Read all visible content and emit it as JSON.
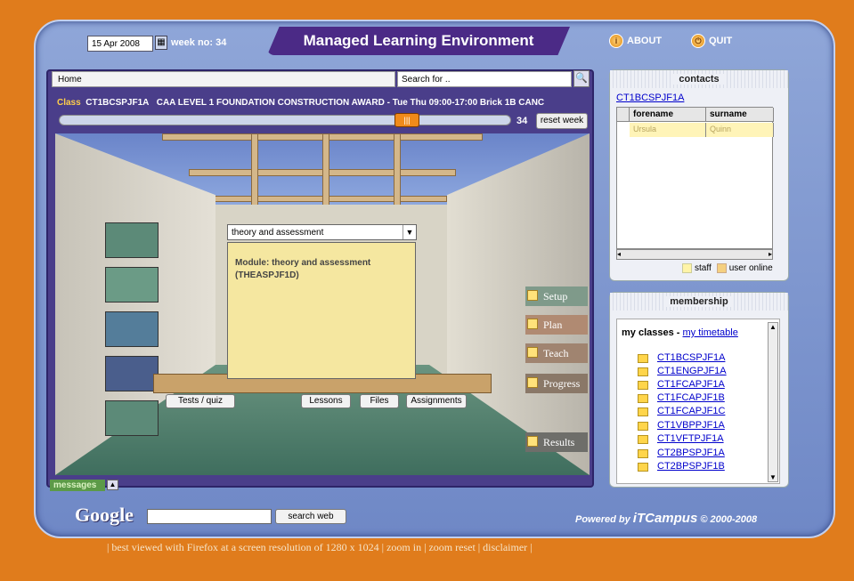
{
  "header": {
    "date": "15 Apr 2008",
    "week_label": "week no: 34",
    "app_title": "Managed Learning Environment",
    "about_label": "ABOUT",
    "quit_label": "QUIT"
  },
  "nav": {
    "home_label": "Home",
    "search_placeholder": "Search for .."
  },
  "class_info": {
    "label": "Class",
    "code": "CT1BCSPJF1A",
    "description": "CAA LEVEL 1 FOUNDATION CONSTRUCTION AWARD - Tue Thu 09:00-17:00 Brick 1B CANC",
    "week_value": "34",
    "reset_label": "reset week"
  },
  "module": {
    "selected": "theory and assessment",
    "text": "Module: theory and assessment (THEASPJF1D)"
  },
  "room_buttons": {
    "tests": "Tests / quiz",
    "lessons": "Lessons",
    "files": "Files",
    "assignments": "Assignments"
  },
  "side_menu": [
    "Setup",
    "Plan",
    "Teach",
    "Progress",
    "Results"
  ],
  "messages": {
    "label": "messages"
  },
  "google": {
    "logo": "Google",
    "search_label": "search web"
  },
  "powered": {
    "prefix": "Powered by ",
    "brand": "iTCampus",
    "suffix": " © 2000-2008"
  },
  "footer": "| best viewed with Firefox at a screen resolution of 1280 x 1024 | zoom in | zoom reset | disclaimer |",
  "contacts": {
    "title": "contacts",
    "class_link": "CT1BCSPJF1A",
    "col_forename": "forename",
    "col_surname": "surname",
    "row_forename": "Ursula",
    "row_surname": "Quinn",
    "legend_staff": "staff",
    "legend_online": "user online",
    "staff_color": "#fff4a8",
    "online_color": "#f5d080"
  },
  "membership": {
    "title": "membership",
    "my_classes": "my classes",
    "sep": " - ",
    "timetable_link": "my timetable",
    "classes": [
      "CT1BCSPJF1A",
      "CT1ENGPJF1A",
      "CT1FCAPJF1A",
      "CT1FCAPJF1B",
      "CT1FCAPJF1C",
      "CT1VBPPJF1A",
      "CT1VFTPJF1A",
      "CT2BPSPJF1A",
      "CT2BPSPJF1B"
    ]
  }
}
